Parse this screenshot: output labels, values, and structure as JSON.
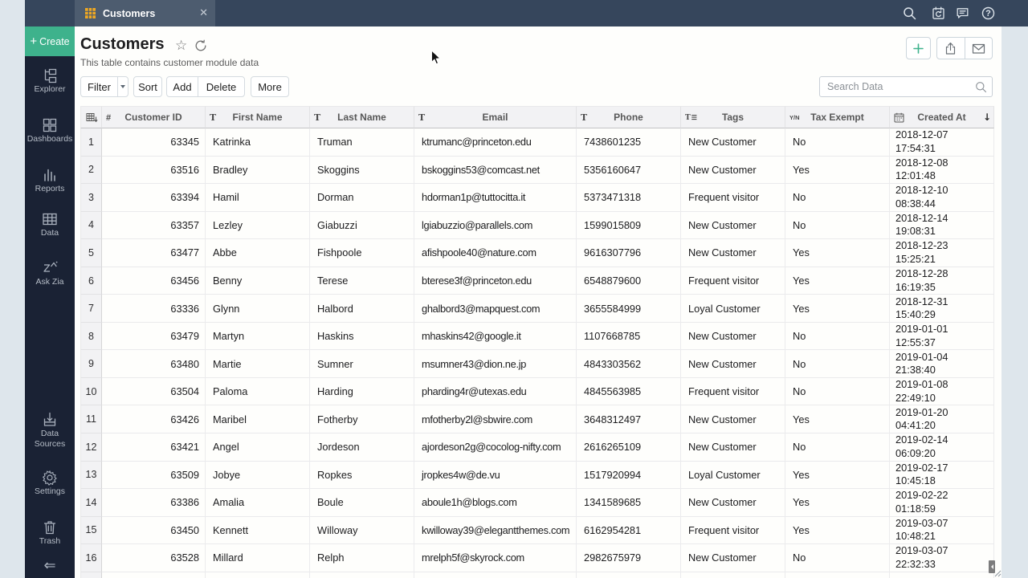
{
  "topbar": {
    "tab": {
      "title": "Customers",
      "close": "×"
    },
    "icons": [
      "search-icon",
      "clipboard-sync-icon",
      "comments-icon",
      "help-icon"
    ]
  },
  "sidebar": {
    "create_label": "Create",
    "items": [
      {
        "id": "explorer",
        "label": "Explorer",
        "icon": "explorer-icon"
      },
      {
        "id": "dashboards",
        "label": "Dashboards",
        "icon": "dashboards-icon"
      },
      {
        "id": "reports",
        "label": "Reports",
        "icon": "reports-icon"
      },
      {
        "id": "data",
        "label": "Data",
        "icon": "data-icon"
      },
      {
        "id": "ask-zia",
        "label": "Ask Zia",
        "icon": "ask-zia-icon"
      },
      {
        "id": "data-sources",
        "label": "Data Sources",
        "icon": "data-sources-icon"
      },
      {
        "id": "settings",
        "label": "Settings",
        "icon": "settings-icon"
      },
      {
        "id": "trash",
        "label": "Trash",
        "icon": "trash-icon"
      }
    ]
  },
  "header": {
    "title": "Customers",
    "subtitle": "This table contains customer module data"
  },
  "toolbar": {
    "filter_label": "Filter",
    "sort_label": "Sort",
    "add_label": "Add",
    "delete_label": "Delete",
    "more_label": "More",
    "search_placeholder": "Search Data"
  },
  "table": {
    "columns": [
      {
        "key": "rownum",
        "label": "",
        "type_icon": "select-all"
      },
      {
        "key": "customer_id",
        "label": "Customer ID",
        "type_icon": "number"
      },
      {
        "key": "first_name",
        "label": "First Name",
        "type_icon": "text"
      },
      {
        "key": "last_name",
        "label": "Last Name",
        "type_icon": "text"
      },
      {
        "key": "email",
        "label": "Email",
        "type_icon": "text"
      },
      {
        "key": "phone",
        "label": "Phone",
        "type_icon": "text"
      },
      {
        "key": "tags",
        "label": "Tags",
        "type_icon": "text-list"
      },
      {
        "key": "tax_exempt",
        "label": "Tax Exempt",
        "type_icon": "boolean"
      },
      {
        "key": "created_at",
        "label": "Created At",
        "type_icon": "date",
        "sorted": "desc"
      }
    ],
    "rows": [
      {
        "num": 1,
        "customer_id": "63345",
        "first_name": "Katrinka",
        "last_name": "Truman",
        "email": "ktrumanc@princeton.edu",
        "phone": "7438601235",
        "tags": "New Customer",
        "tax_exempt": "No",
        "created_date": "2018-12-07",
        "created_time": "17:54:31"
      },
      {
        "num": 2,
        "customer_id": "63516",
        "first_name": "Bradley",
        "last_name": "Skoggins",
        "email": "bskoggins53@comcast.net",
        "phone": "5356160647",
        "tags": "New Customer",
        "tax_exempt": "Yes",
        "created_date": "2018-12-08",
        "created_time": "12:01:48"
      },
      {
        "num": 3,
        "customer_id": "63394",
        "first_name": "Hamil",
        "last_name": "Dorman",
        "email": "hdorman1p@tuttocitta.it",
        "phone": "5373471318",
        "tags": "Frequent visitor",
        "tax_exempt": "No",
        "created_date": "2018-12-10",
        "created_time": "08:38:44"
      },
      {
        "num": 4,
        "customer_id": "63357",
        "first_name": "Lezley",
        "last_name": "Giabuzzi",
        "email": "lgiabuzzio@parallels.com",
        "phone": "1599015809",
        "tags": "New Customer",
        "tax_exempt": "No",
        "created_date": "2018-12-14",
        "created_time": "19:08:31"
      },
      {
        "num": 5,
        "customer_id": "63477",
        "first_name": "Abbe",
        "last_name": "Fishpoole",
        "email": "afishpoole40@nature.com",
        "phone": "9616307796",
        "tags": "New Customer",
        "tax_exempt": "Yes",
        "created_date": "2018-12-23",
        "created_time": "15:25:21"
      },
      {
        "num": 6,
        "customer_id": "63456",
        "first_name": "Benny",
        "last_name": "Terese",
        "email": "bterese3f@princeton.edu",
        "phone": "6548879600",
        "tags": "Frequent visitor",
        "tax_exempt": "Yes",
        "created_date": "2018-12-28",
        "created_time": "16:19:35"
      },
      {
        "num": 7,
        "customer_id": "63336",
        "first_name": "Glynn",
        "last_name": "Halbord",
        "email": "ghalbord3@mapquest.com",
        "phone": "3655584999",
        "tags": "Loyal Customer",
        "tax_exempt": "Yes",
        "created_date": "2018-12-31",
        "created_time": "15:40:29"
      },
      {
        "num": 8,
        "customer_id": "63479",
        "first_name": "Martyn",
        "last_name": "Haskins",
        "email": "mhaskins42@google.it",
        "phone": "1107668785",
        "tags": "New Customer",
        "tax_exempt": "No",
        "created_date": "2019-01-01",
        "created_time": "12:55:37"
      },
      {
        "num": 9,
        "customer_id": "63480",
        "first_name": "Martie",
        "last_name": "Sumner",
        "email": "msumner43@dion.ne.jp",
        "phone": "4843303562",
        "tags": "New Customer",
        "tax_exempt": "No",
        "created_date": "2019-01-04",
        "created_time": "21:38:40"
      },
      {
        "num": 10,
        "customer_id": "63504",
        "first_name": "Paloma",
        "last_name": "Harding",
        "email": "pharding4r@utexas.edu",
        "phone": "4845563985",
        "tags": "Frequent visitor",
        "tax_exempt": "No",
        "created_date": "2019-01-08",
        "created_time": "22:49:10"
      },
      {
        "num": 11,
        "customer_id": "63426",
        "first_name": "Maribel",
        "last_name": "Fotherby",
        "email": "mfotherby2l@sbwire.com",
        "phone": "3648312497",
        "tags": "New Customer",
        "tax_exempt": "Yes",
        "created_date": "2019-01-20",
        "created_time": "04:41:20"
      },
      {
        "num": 12,
        "customer_id": "63421",
        "first_name": "Angel",
        "last_name": "Jordeson",
        "email": "ajordeson2g@cocolog-nifty.com",
        "phone": "2616265109",
        "tags": "New Customer",
        "tax_exempt": "No",
        "created_date": "2019-02-14",
        "created_time": "06:09:20"
      },
      {
        "num": 13,
        "customer_id": "63509",
        "first_name": "Jobye",
        "last_name": "Ropkes",
        "email": "jropkes4w@de.vu",
        "phone": "1517920994",
        "tags": "Loyal Customer",
        "tax_exempt": "Yes",
        "created_date": "2019-02-17",
        "created_time": "10:45:18"
      },
      {
        "num": 14,
        "customer_id": "63386",
        "first_name": "Amalia",
        "last_name": "Boule",
        "email": "aboule1h@blogs.com",
        "phone": "1341589685",
        "tags": "New Customer",
        "tax_exempt": "Yes",
        "created_date": "2019-02-22",
        "created_time": "01:18:59"
      },
      {
        "num": 15,
        "customer_id": "63450",
        "first_name": "Kennett",
        "last_name": "Willoway",
        "email": "kwilloway39@elegantthemes.com",
        "phone": "6162954281",
        "tags": "Frequent visitor",
        "tax_exempt": "Yes",
        "created_date": "2019-03-07",
        "created_time": "10:48:21"
      },
      {
        "num": 16,
        "customer_id": "63528",
        "first_name": "Millard",
        "last_name": "Relph",
        "email": "mrelph5f@skyrock.com",
        "phone": "2982675979",
        "tags": "New Customer",
        "tax_exempt": "No",
        "created_date": "2019-03-07",
        "created_time": "22:32:33"
      }
    ]
  },
  "colors": {
    "accent_green": "#3eb28c",
    "topbar_bg": "#36465c",
    "tab_bg": "#4d5c6f",
    "sidebar_bg": "#1a2234",
    "page_bg": "#dee6ec",
    "sheet_bg": "#fefefc",
    "table_header_bg": "#f2f2f4",
    "tab_icon_yellow": "#f0a822"
  }
}
